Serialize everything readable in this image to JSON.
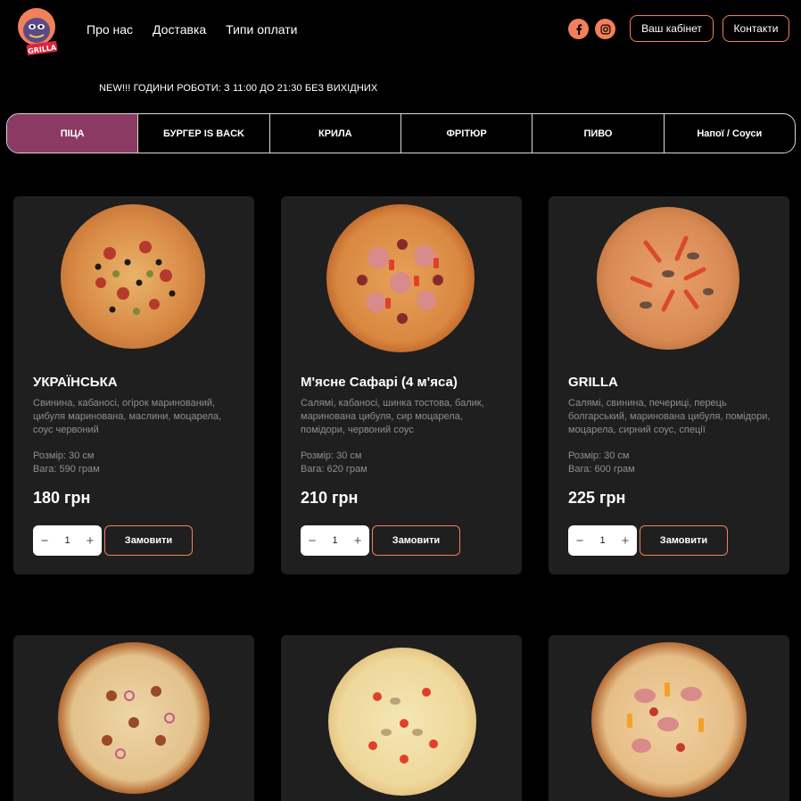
{
  "header": {
    "logo_text": "GRILLA",
    "nav": [
      "Про нас",
      "Доставка",
      "Типи оплати"
    ],
    "social": [
      "facebook-icon",
      "instagram-icon"
    ],
    "cabinet_label": "Ваш кабінет",
    "contacts_label": "Контакти"
  },
  "notice": "NEW!!! ГОДИНИ РОБОТИ: З 11:00 ДО 21:30 БЕЗ ВИХІДНИХ",
  "tabs": [
    "ПІЦА",
    "БУРГЕР IS BACK",
    "КРИЛА",
    "ФРІТЮР",
    "ПИВО",
    "Напої / Соуси"
  ],
  "active_tab": 0,
  "order_label": "Замовити",
  "products": [
    {
      "name": "УКРАЇНСЬКА",
      "description": "Свинина, кабаносі, огірок маринований, цибуля маринована, маслини, моцарела, соус червоний",
      "size": "Розмір: 30 см",
      "weight": "Вага: 590 грам",
      "price": "180 грн",
      "qty": "1"
    },
    {
      "name": "М'ясне Сафарі (4 м'яса)",
      "description": "Салямі, кабаносі, шинка тостова, балик, маринована цибуля, сир моцарела, помідори, червоний соус",
      "size": "Розмір: 30 см",
      "weight": "Вага: 620 грам",
      "price": "210 грн",
      "qty": "1"
    },
    {
      "name": "GRILLA",
      "description": "Салямі, свинина, печериці, перець болгарський, маринована цибуля, помідори, моцарела, сирний соус, спеції",
      "size": "Розмір: 30 см",
      "weight": "Вага: 600 грам",
      "price": "225 грн",
      "qty": "1"
    }
  ],
  "colors": {
    "accent": "#f2805a",
    "active_tab": "#8a3a63",
    "card_bg": "#1f1f1f",
    "page_bg": "#000000"
  }
}
